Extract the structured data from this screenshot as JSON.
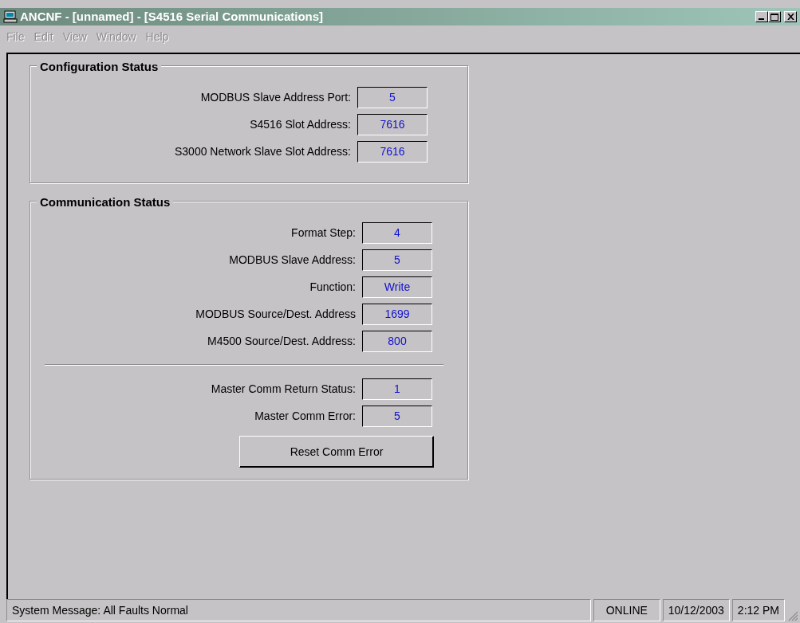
{
  "window": {
    "title": "ANCNF - [unnamed] - [S4516 Serial Communications]"
  },
  "menu": [
    {
      "label": "File",
      "disabled": true
    },
    {
      "label": "Edit",
      "disabled": true
    },
    {
      "label": "View",
      "disabled": true
    },
    {
      "label": "Window",
      "disabled": true
    },
    {
      "label": "Help",
      "disabled": true
    }
  ],
  "configuration_status": {
    "title": "Configuration Status",
    "fields": [
      {
        "label": "MODBUS Slave Address Port:",
        "value": "5"
      },
      {
        "label": "S4516 Slot Address:",
        "value": "7616"
      },
      {
        "label": "S3000 Network Slave Slot Address:",
        "value": "7616"
      }
    ]
  },
  "communication_status": {
    "title": "Communication Status",
    "fields": [
      {
        "label": "Format Step:",
        "value": "4"
      },
      {
        "label": "MODBUS Slave Address:",
        "value": "5"
      },
      {
        "label": "Function:",
        "value": "Write"
      },
      {
        "label": "MODBUS Source/Dest. Address",
        "value": "1699"
      },
      {
        "label": "M4500 Source/Dest. Address:",
        "value": "800"
      }
    ],
    "return_fields": [
      {
        "label": "Master Comm Return Status:",
        "value": "1"
      },
      {
        "label": "Master Comm Error:",
        "value": "5"
      }
    ],
    "button": "Reset Comm Error"
  },
  "status_bar": {
    "message": "System Message:  All Faults Normal",
    "connection": "ONLINE",
    "date": "10/12/2003",
    "time": "2:12 PM"
  }
}
